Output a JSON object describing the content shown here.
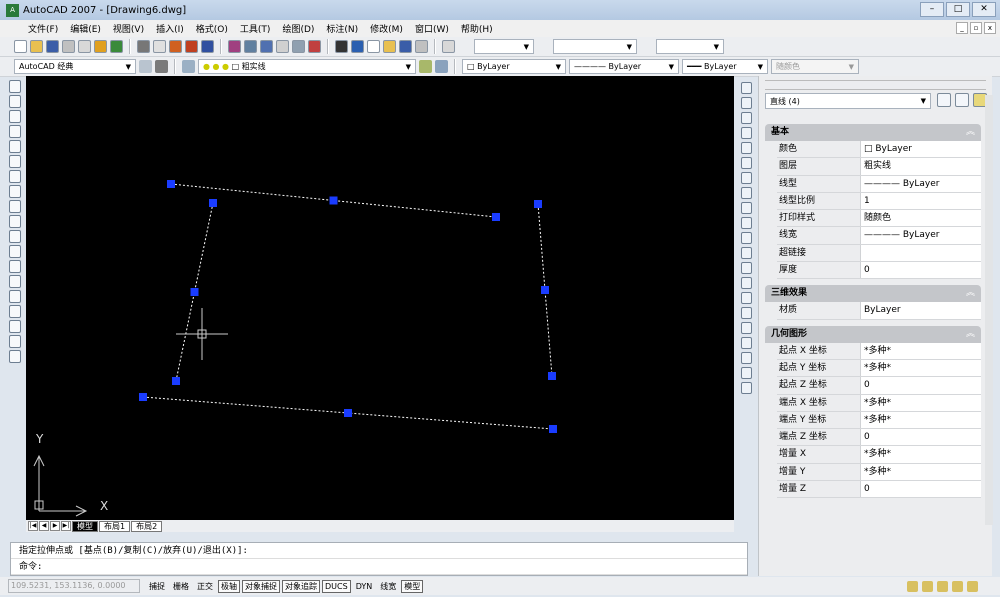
{
  "window": {
    "title": "AutoCAD 2007 - [Drawing6.dwg]",
    "logo": "autocad-logo"
  },
  "menu": [
    "文件(F)",
    "编辑(E)",
    "视图(V)",
    "插入(I)",
    "格式(O)",
    "工具(T)",
    "绘图(D)",
    "标注(N)",
    "修改(M)",
    "窗口(W)",
    "帮助(H)"
  ],
  "toolbar2": {
    "workspace": "AutoCAD 经典",
    "layer": "粗实线",
    "color": "ByLayer",
    "linetype": "ByLayer",
    "lineweight": "ByLayer",
    "plotstyle": "随颜色"
  },
  "layout_tabs": [
    "模型",
    "布局1",
    "布局2"
  ],
  "command": {
    "history": "指定拉伸点或 [基点(B)/复制(C)/放弃(U)/退出(X)]:",
    "prompt": "命令:"
  },
  "status": {
    "coords": "109.5231, 153.1136, 0.0000",
    "buttons": [
      {
        "label": "捕捉",
        "on": false
      },
      {
        "label": "栅格",
        "on": false
      },
      {
        "label": "正交",
        "on": false
      },
      {
        "label": "极轴",
        "on": true
      },
      {
        "label": "对象捕捉",
        "on": true
      },
      {
        "label": "对象追踪",
        "on": true
      },
      {
        "label": "DUCS",
        "on": true
      },
      {
        "label": "DYN",
        "on": false
      },
      {
        "label": "线宽",
        "on": false
      },
      {
        "label": "模型",
        "on": true
      }
    ]
  },
  "ucs": {
    "x": "X",
    "y": "Y"
  },
  "properties": {
    "selection": "直线 (4)",
    "categories": [
      {
        "name": "基本",
        "rows": [
          [
            "颜色",
            "□ ByLayer"
          ],
          [
            "图层",
            "粗实线"
          ],
          [
            "线型",
            "———— ByLayer"
          ],
          [
            "线型比例",
            "1"
          ],
          [
            "打印样式",
            "随颜色"
          ],
          [
            "线宽",
            "———— ByLayer"
          ],
          [
            "超链接",
            ""
          ],
          [
            "厚度",
            "0"
          ]
        ]
      },
      {
        "name": "三维效果",
        "rows": [
          [
            "材质",
            "ByLayer"
          ]
        ]
      },
      {
        "name": "几何图形",
        "rows": [
          [
            "起点 X 坐标",
            "*多种*"
          ],
          [
            "起点 Y 坐标",
            "*多种*"
          ],
          [
            "起点 Z 坐标",
            "0"
          ],
          [
            "端点 X 坐标",
            "*多种*"
          ],
          [
            "端点 Y 坐标",
            "*多种*"
          ],
          [
            "端点 Z 坐标",
            "0"
          ],
          [
            "增量 X",
            "*多种*"
          ],
          [
            "增量 Y",
            "*多种*"
          ],
          [
            "增量 Z",
            "0"
          ]
        ]
      }
    ]
  },
  "colors": {
    "canvas": "#000000",
    "grip": "#1a3cff",
    "line": "#ffffff"
  }
}
